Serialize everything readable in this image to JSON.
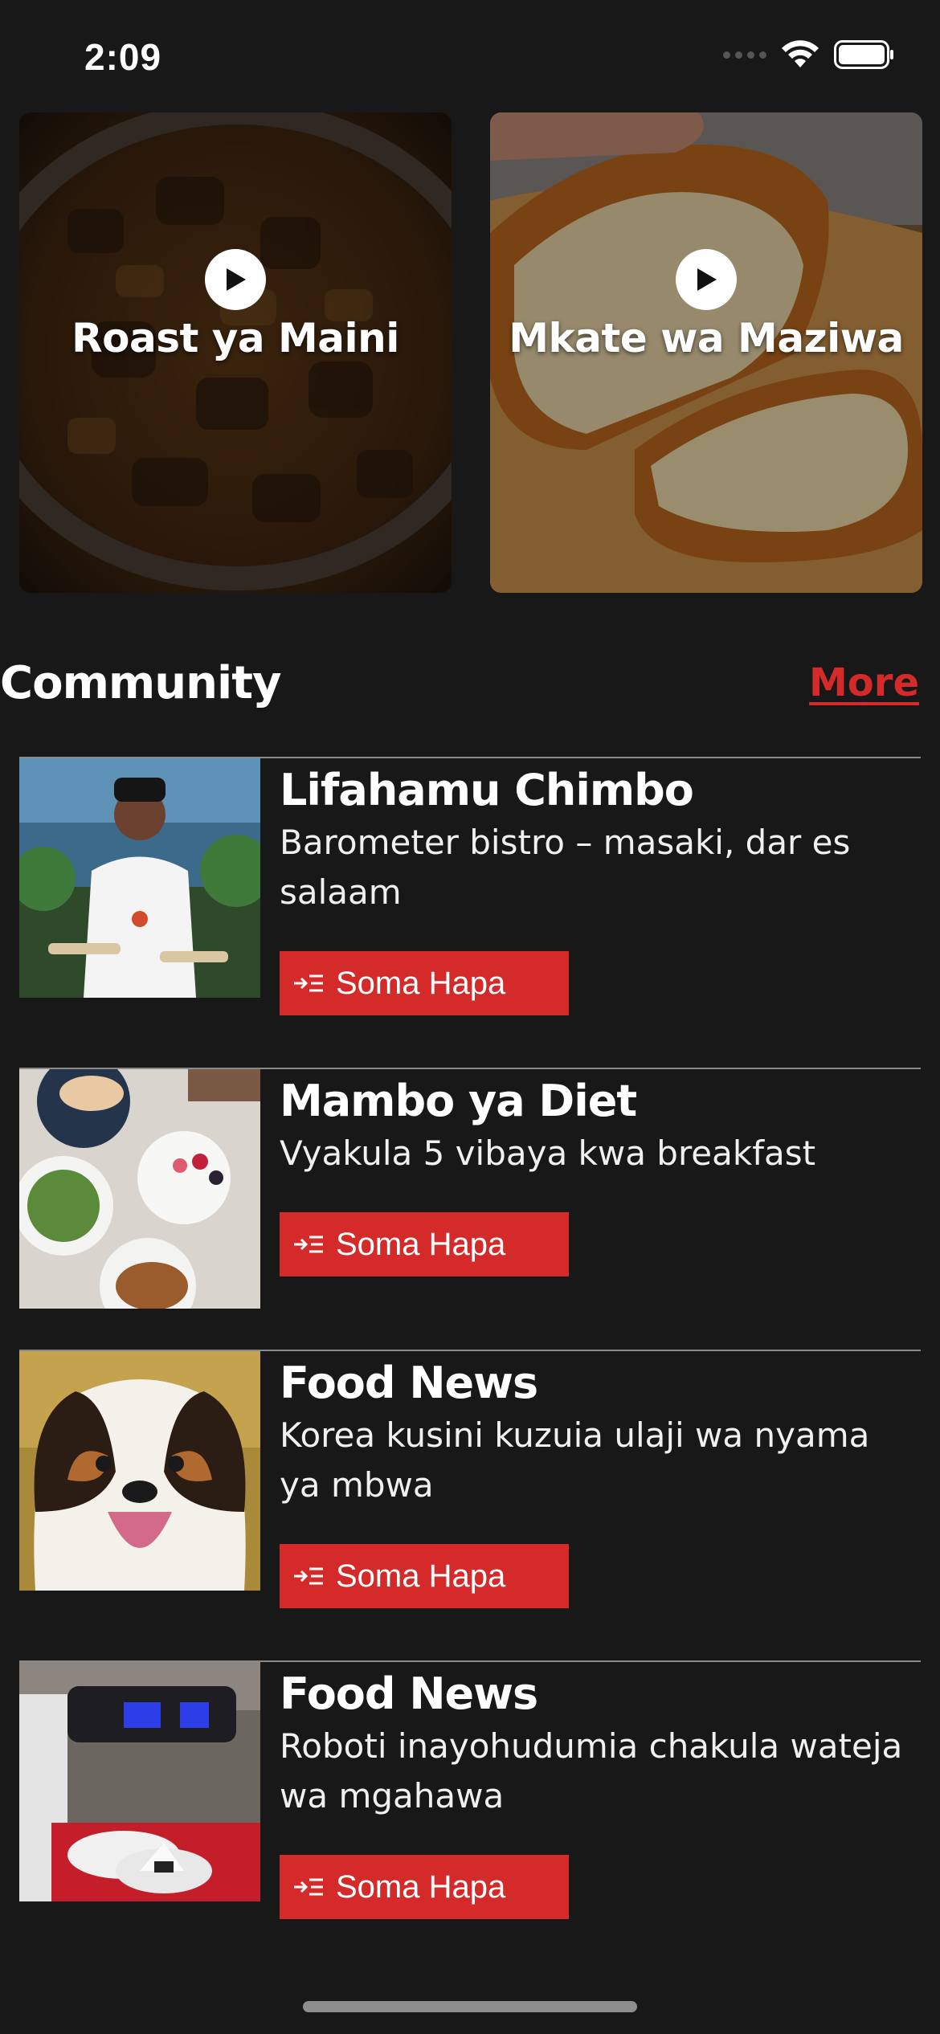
{
  "status_bar": {
    "time": "2:09"
  },
  "videos": [
    {
      "title": "Roast ya Maini",
      "icon": "play-icon"
    },
    {
      "title": "Mkate wa Maziwa",
      "icon": "play-icon"
    }
  ],
  "community": {
    "heading": "Community",
    "more_label": "More",
    "accent_color": "#d42a2a",
    "articles": [
      {
        "title": "Lifahamu Chimbo",
        "description": "Barometer bistro – masaki, dar es salaam",
        "button_label": "Soma Hapa"
      },
      {
        "title": "Mambo ya Diet",
        "description": "Vyakula 5 vibaya kwa breakfast",
        "button_label": "Soma Hapa"
      },
      {
        "title": "Food News",
        "description": "Korea kusini kuzuia ulaji wa nyama ya mbwa",
        "button_label": "Soma Hapa"
      },
      {
        "title": "Food News",
        "description": "Roboti inayohudumia chakula wateja wa mgahawa",
        "button_label": "Soma Hapa"
      }
    ]
  }
}
